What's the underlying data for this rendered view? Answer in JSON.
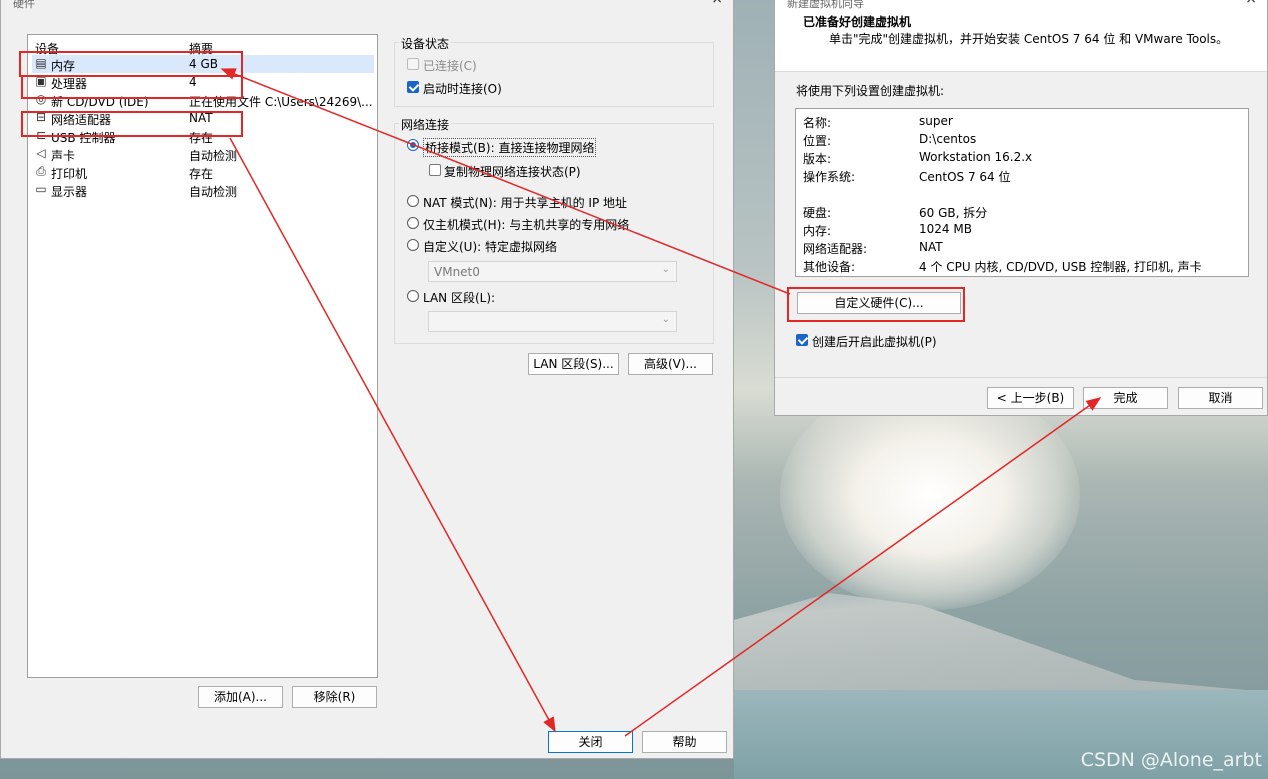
{
  "hardware_window": {
    "title": "硬件",
    "close_glyph": "×",
    "device_list": {
      "col_device": "设备",
      "col_summary": "摘要",
      "rows": [
        {
          "icon": "memory-icon",
          "glyph": "▤",
          "name": "内存",
          "summary": "4 GB"
        },
        {
          "icon": "processor-icon",
          "glyph": "▣",
          "name": "处理器",
          "summary": "4"
        },
        {
          "icon": "cd-dvd-icon",
          "glyph": "◎",
          "name": "新 CD/DVD (IDE)",
          "summary": "正在使用文件 C:\\Users\\24269\\..."
        },
        {
          "icon": "network-adapter-icon",
          "glyph": "⊟",
          "name": "网络适配器",
          "summary": "NAT"
        },
        {
          "icon": "usb-controller-icon",
          "glyph": "⊏",
          "name": "USB 控制器",
          "summary": "存在"
        },
        {
          "icon": "sound-card-icon",
          "glyph": "◁",
          "name": "声卡",
          "summary": "自动检测"
        },
        {
          "icon": "printer-icon",
          "glyph": "⎙",
          "name": "打印机",
          "summary": "存在"
        },
        {
          "icon": "display-icon",
          "glyph": "▭",
          "name": "显示器",
          "summary": "自动检测"
        }
      ]
    },
    "device_status": {
      "label": "设备状态",
      "connected": {
        "label": "已连接(C)",
        "checked": false,
        "disabled": true
      },
      "connect_at_power_on": {
        "label": "启动时连接(O)",
        "checked": true
      }
    },
    "network_connection": {
      "label": "网络连接",
      "bridged": {
        "label": "桥接模式(B): 直接连接物理网络",
        "selected": true
      },
      "replicate": {
        "label": "复制物理网络连接状态(P)",
        "checked": false
      },
      "nat": {
        "label": "NAT 模式(N): 用于共享主机的 IP 地址",
        "selected": false
      },
      "host_only": {
        "label": "仅主机模式(H): 与主机共享的专用网络",
        "selected": false
      },
      "custom": {
        "label": "自定义(U): 特定虚拟网络",
        "selected": false
      },
      "custom_select": "VMnet0",
      "lan_segment": {
        "label": "LAN 区段(L):",
        "selected": false
      },
      "lan_select": ""
    },
    "buttons": {
      "lan_segments": "LAN 区段(S)...",
      "advanced": "高级(V)...",
      "add": "添加(A)...",
      "remove": "移除(R)",
      "close": "关闭",
      "help": "帮助"
    }
  },
  "wizard_window": {
    "title": "新建虚拟机向导",
    "close_glyph": "×",
    "heading": "已准备好创建虚拟机",
    "subheading": "单击\"完成\"创建虚拟机，并开始安装 CentOS 7 64 位 和 VMware Tools。",
    "settings_intro": "将使用下列设置创建虚拟机:",
    "summary": [
      {
        "key": "名称:",
        "value": "super"
      },
      {
        "key": "位置:",
        "value": "D:\\centos"
      },
      {
        "key": "版本:",
        "value": "Workstation 16.2.x"
      },
      {
        "key": "操作系统:",
        "value": "CentOS 7 64 位"
      },
      {
        "key": "硬盘:",
        "value": "60 GB, 拆分"
      },
      {
        "key": "内存:",
        "value": "1024 MB"
      },
      {
        "key": "网络适配器:",
        "value": "NAT"
      },
      {
        "key": "其他设备:",
        "value": "4 个 CPU 内核, CD/DVD, USB 控制器, 打印机, 声卡"
      }
    ],
    "customize_hardware": "自定义硬件(C)...",
    "power_on_after": {
      "label": "创建后开启此虚拟机(P)",
      "checked": true
    },
    "buttons": {
      "back": "< 上一步(B)",
      "finish": "完成",
      "cancel": "取消"
    }
  },
  "watermark": "CSDN @Alone_arbt",
  "colors": {
    "annotation_red": "#e32626",
    "accent_blue": "#1a66c6",
    "selection": "#d9e8fb"
  }
}
